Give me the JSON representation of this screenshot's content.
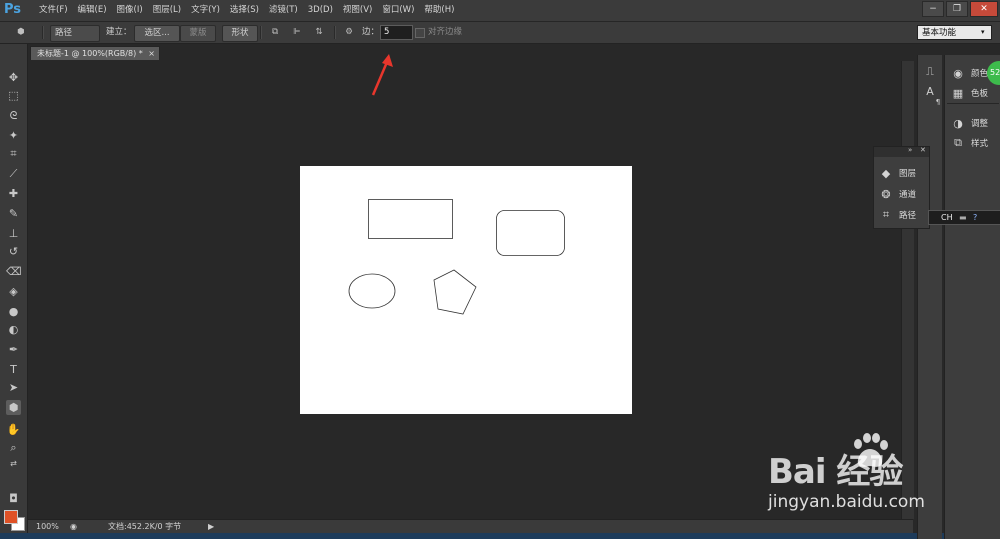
{
  "app": {
    "logo": "Ps"
  },
  "menu": [
    "文件(F)",
    "编辑(E)",
    "图像(I)",
    "图层(L)",
    "文字(Y)",
    "选择(S)",
    "滤镜(T)",
    "3D(D)",
    "视图(V)",
    "窗口(W)",
    "帮助(H)"
  ],
  "window_buttons": {
    "minimize": "−",
    "restore": "❐",
    "close": "✕"
  },
  "options": {
    "mode_select": "路径",
    "make_label": "建立：",
    "selection_btn": "选区...",
    "mask_btn": "蒙版",
    "shape_btn": "形状",
    "sides_label": "边：",
    "sides_value": "5",
    "align_edges_label": "对齐边缘",
    "workspace": "基本功能"
  },
  "document": {
    "tab_title": "未标题-1 @ 100%(RGB/8) *",
    "tab_close": "×",
    "zoom": "100%",
    "info": "文档:452.2K/0 字节"
  },
  "tools": [
    {
      "name": "move-tool",
      "glyph": "✥"
    },
    {
      "name": "marquee-tool",
      "glyph": "⬚"
    },
    {
      "name": "lasso-tool",
      "glyph": "ᘓ"
    },
    {
      "name": "magic-wand-tool",
      "glyph": "✦"
    },
    {
      "name": "crop-tool",
      "glyph": "⌗"
    },
    {
      "name": "eyedropper-tool",
      "glyph": "⟋"
    },
    {
      "name": "healing-brush-tool",
      "glyph": "✚"
    },
    {
      "name": "brush-tool",
      "glyph": "✎"
    },
    {
      "name": "clone-stamp-tool",
      "glyph": "⊥"
    },
    {
      "name": "history-brush-tool",
      "glyph": "↺"
    },
    {
      "name": "eraser-tool",
      "glyph": "⌫"
    },
    {
      "name": "paint-bucket-tool",
      "glyph": "◈"
    },
    {
      "name": "blur-tool",
      "glyph": "●"
    },
    {
      "name": "dodge-tool",
      "glyph": "◐"
    },
    {
      "name": "pen-tool",
      "glyph": "✒"
    },
    {
      "name": "type-tool",
      "glyph": "T"
    },
    {
      "name": "path-selection-tool",
      "glyph": "➤"
    },
    {
      "name": "shape-tool",
      "glyph": "⬢"
    },
    {
      "name": "hand-tool",
      "glyph": "✋"
    },
    {
      "name": "zoom-tool",
      "glyph": "⌕"
    }
  ],
  "dock2_panels": [
    {
      "label": "颜色",
      "icon": "palette-icon",
      "glyph": "◉"
    },
    {
      "label": "色板",
      "icon": "swatches-icon",
      "glyph": "▦"
    },
    {
      "label": "调整",
      "icon": "adjustments-icon",
      "glyph": "◑"
    },
    {
      "label": "样式",
      "icon": "styles-icon",
      "glyph": "⧉"
    }
  ],
  "float_panels": [
    {
      "label": "图层",
      "icon": "layers-icon",
      "glyph": "◆"
    },
    {
      "label": "通道",
      "icon": "channels-icon",
      "glyph": "❂"
    },
    {
      "label": "路径",
      "icon": "paths-icon",
      "glyph": "⌗"
    }
  ],
  "ime": {
    "text": "CH"
  },
  "notification": {
    "text": "52"
  },
  "watermark": {
    "brand": "Bai  经验",
    "url": "jingyan.baidu.com"
  },
  "colors": {
    "foreground": "#e05226",
    "background": "#ffffff",
    "annotation_arrow": "#e8362c"
  }
}
